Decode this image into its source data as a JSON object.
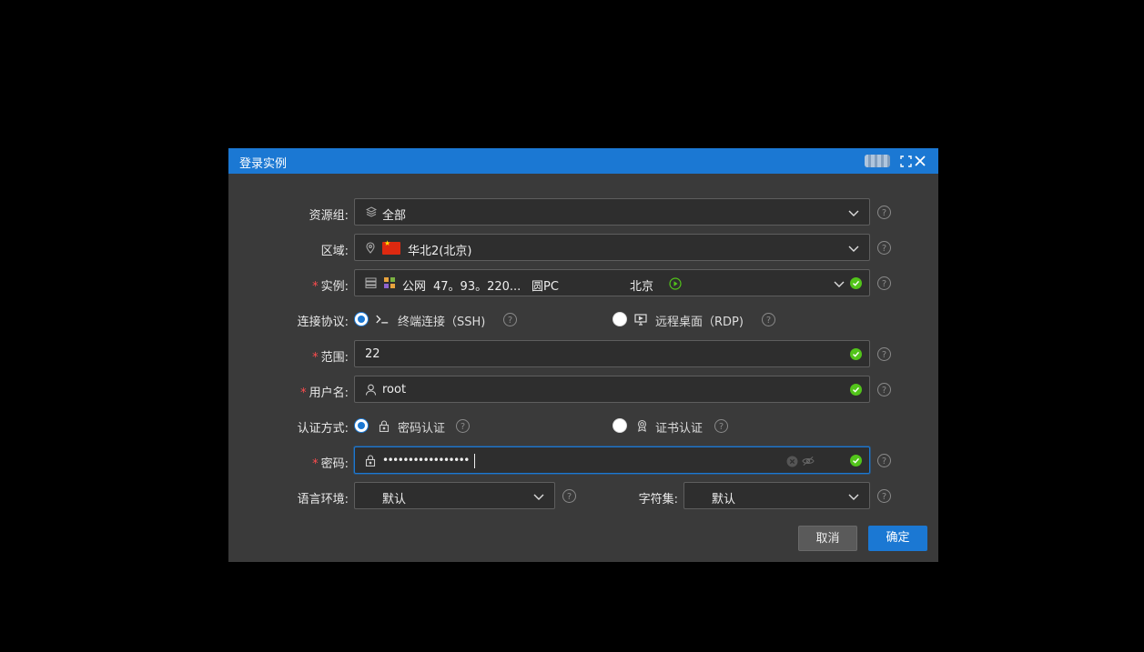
{
  "dialog": {
    "title": "登录实例"
  },
  "form": {
    "resource_group": {
      "label": "资源组:",
      "value": "全部"
    },
    "region": {
      "label": "区域:",
      "value": "华北2(北京)"
    },
    "instance": {
      "label": "实例:",
      "network": "公网",
      "ip": "47。93。220...",
      "name": "圆PC",
      "city": "北京",
      "status_color": "#52c41a"
    },
    "protocol": {
      "label": "连接协议:",
      "options": [
        {
          "label": "终端连接（SSH)",
          "selected": true,
          "icon": "terminal-icon"
        },
        {
          "label": "远程桌面（RDP)",
          "selected": false,
          "icon": "desktop-icon"
        }
      ]
    },
    "port": {
      "label": "范围:",
      "value": "22"
    },
    "username": {
      "label": "用户名:",
      "value": "root"
    },
    "auth": {
      "label": "认证方式:",
      "options": [
        {
          "label": "密码认证",
          "selected": true,
          "icon": "lock-icon"
        },
        {
          "label": "证书认证",
          "selected": false,
          "icon": "certificate-icon"
        }
      ]
    },
    "password": {
      "label": "密码:",
      "value": "•••••••••••••••••"
    },
    "locale": {
      "label": "语言环境:",
      "value": "默认"
    },
    "charset": {
      "label": "字符集:",
      "value": "默认"
    }
  },
  "buttons": {
    "cancel": "取消",
    "confirm": "确定"
  },
  "required_mark": "*",
  "colors": {
    "accent": "#1b78d3",
    "success": "#52c41a",
    "required": "#ff4d4f"
  }
}
